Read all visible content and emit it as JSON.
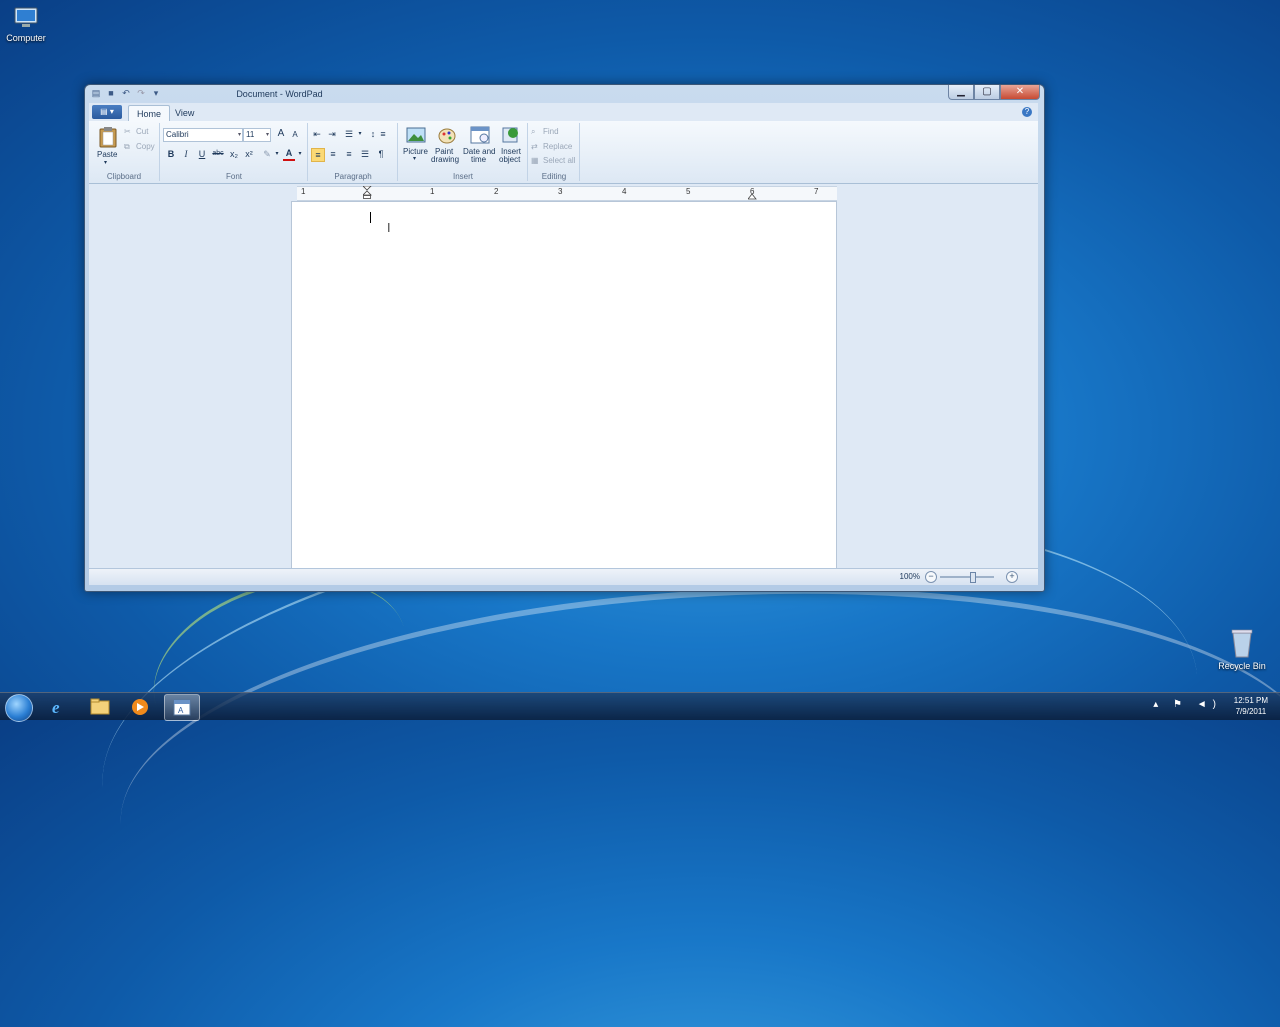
{
  "desktop": {
    "computer_label": "Computer",
    "recycle_label": "Recycle Bin"
  },
  "window": {
    "title": "Document - WordPad",
    "min": "▁",
    "max": "▢",
    "close": "✕"
  },
  "ribbon": {
    "tabs": [
      "Home",
      "View"
    ],
    "clipboard": {
      "paste": "Paste",
      "cut": "Cut",
      "copy": "Copy",
      "group": "Clipboard"
    },
    "font": {
      "family": "Calibri",
      "size": "11",
      "group": "Font",
      "bold": "B",
      "italic": "I",
      "underline": "U",
      "strike": "abc",
      "sub": "x₂",
      "sup": "x²",
      "grow": "A",
      "shrink": "A",
      "color": "A"
    },
    "paragraph": {
      "group": "Paragraph"
    },
    "insert": {
      "picture": "Picture",
      "paint": "Paint",
      "paint2": "drawing",
      "date": "Date and",
      "date2": "time",
      "object": "Insert",
      "object2": "object",
      "group": "Insert"
    },
    "editing": {
      "find": "Find",
      "replace": "Replace",
      "select_all": "Select all",
      "group": "Editing"
    }
  },
  "ruler": {
    "numbers": [
      "1",
      "1",
      "2",
      "3",
      "4",
      "5",
      "6",
      "7"
    ]
  },
  "status": {
    "zoom": "100%",
    "zoom_out": "−",
    "zoom_in": "+"
  },
  "taskbar": {
    "time": "12:51 PM",
    "date": "7/9/2011"
  }
}
